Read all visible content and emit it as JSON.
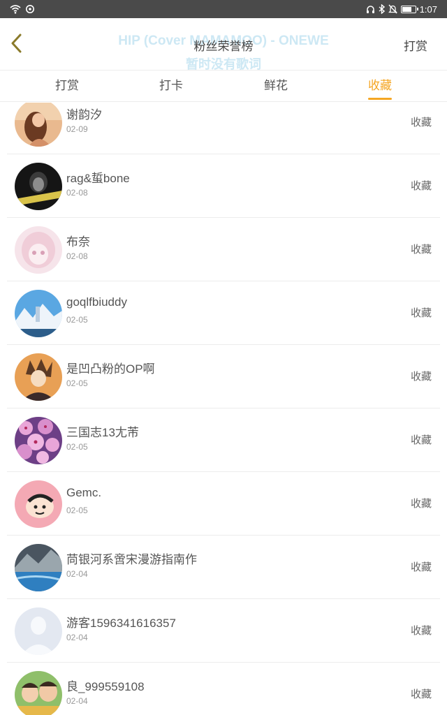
{
  "status_bar": {
    "time": "1:07",
    "left_icons": [
      "wifi-icon",
      "sync-icon"
    ],
    "right_icons": [
      "headphones-icon",
      "bluetooth-icon",
      "mute-icon",
      "battery-icon"
    ],
    "battery_level": 0.75
  },
  "header": {
    "back_icon": "chevron-left-icon",
    "lyric_line1": "HIP (Cover MAMAMOO) - ONEWE",
    "lyric_line2": "暂时没有歌词",
    "title": "粉丝荣誉榜",
    "action_label": "打赏"
  },
  "tabs": [
    {
      "label": "打赏",
      "active": false
    },
    {
      "label": "打卡",
      "active": false
    },
    {
      "label": "鲜花",
      "active": false
    },
    {
      "label": "收藏",
      "active": true
    }
  ],
  "colors": {
    "accent": "#f5a623",
    "status_bar": "#4a4a4a",
    "divider": "#ececec",
    "lyric_overlay": "#cde8f4"
  },
  "fans": [
    {
      "name": "谢韵汐",
      "date": "02-09",
      "type": "收藏",
      "avatar": "photo-woman-avatar"
    },
    {
      "name": "rag&蜇bone",
      "date": "02-08",
      "type": "收藏",
      "avatar": "dark-portrait-avatar"
    },
    {
      "name": "布奈",
      "date": "02-08",
      "type": "收藏",
      "avatar": "anime-girl-avatar"
    },
    {
      "name": "goqlfbiuddy",
      "date": "02-05",
      "type": "收藏",
      "avatar": "snowy-castle-avatar"
    },
    {
      "name": "是凹凸粉的OP啊",
      "date": "02-05",
      "type": "收藏",
      "avatar": "anime-character-avatar"
    },
    {
      "name": "三国志13尢芾",
      "date": "02-05",
      "type": "收藏",
      "avatar": "flowers-avatar"
    },
    {
      "name": "Gemc.",
      "date": "02-05",
      "type": "收藏",
      "avatar": "cartoon-avatar"
    },
    {
      "name": "苘银河系啻宋漫游指南作",
      "date": "02-04",
      "type": "收藏",
      "avatar": "seascape-avatar"
    },
    {
      "name": "游客1596341616357",
      "date": "02-04",
      "type": "收藏",
      "avatar": "default-user-avatar"
    },
    {
      "name": "良_999559108",
      "date": "02-04",
      "type": "收藏",
      "avatar": "children-photo-avatar"
    }
  ]
}
